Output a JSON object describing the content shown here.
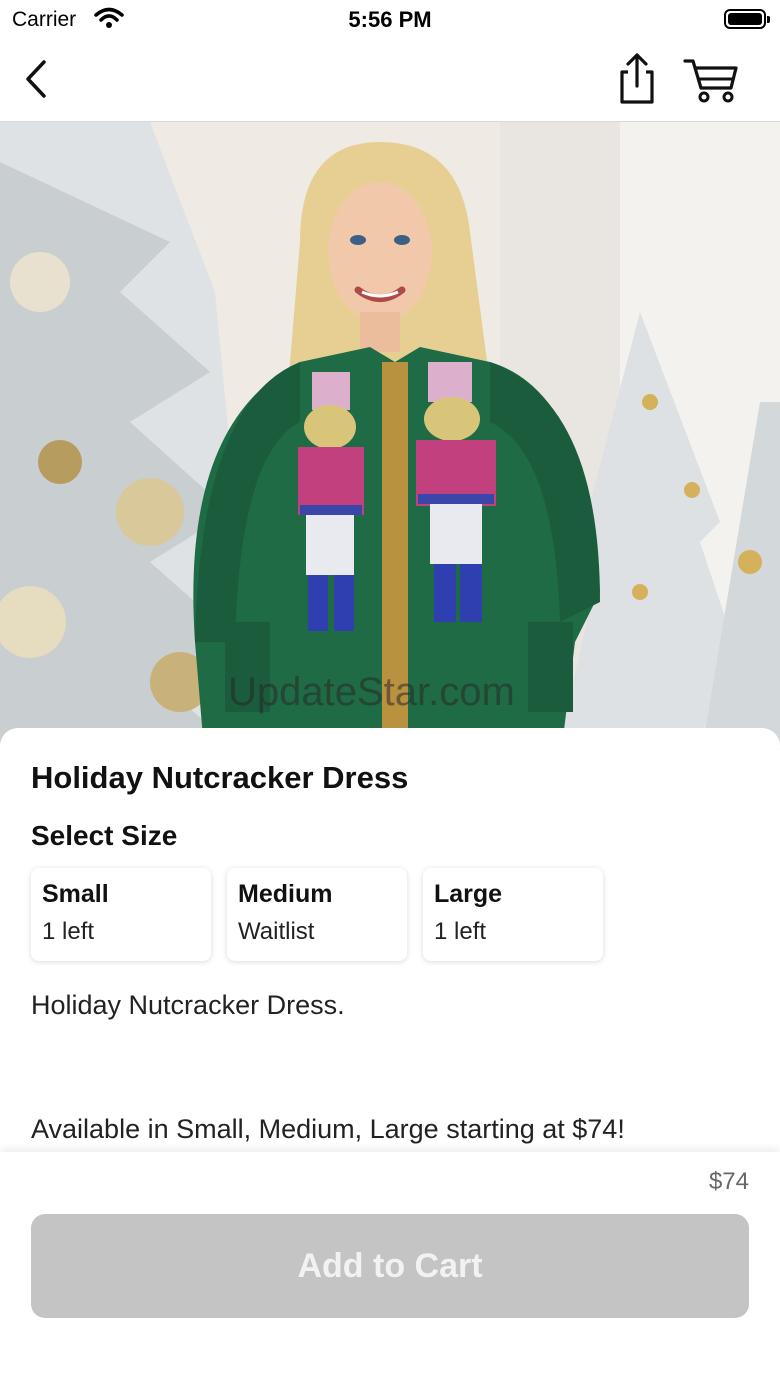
{
  "status_bar": {
    "carrier": "Carrier",
    "time": "5:56 PM"
  },
  "nav": {
    "back_icon": "chevron-left-icon",
    "share_icon": "share-icon",
    "cart_icon": "cart-icon"
  },
  "hero": {
    "watermark": "UpdateStar.com"
  },
  "product": {
    "title": "Holiday Nutcracker Dress",
    "size_heading": "Select Size",
    "sizes": [
      {
        "name": "Small",
        "stock": "1 left"
      },
      {
        "name": "Medium",
        "stock": "Waitlist"
      },
      {
        "name": "Large",
        "stock": "1 left"
      }
    ],
    "description_line1": "Holiday Nutcracker Dress.",
    "description_line2": "Available in Small, Medium, Large starting at $74!"
  },
  "footer": {
    "price": "$74",
    "add_to_cart_label": "Add to Cart"
  },
  "colors": {
    "button_disabled": "#c4c4c4",
    "dress_green": "#1f6b45",
    "sequin_pink": "#c2407e"
  }
}
